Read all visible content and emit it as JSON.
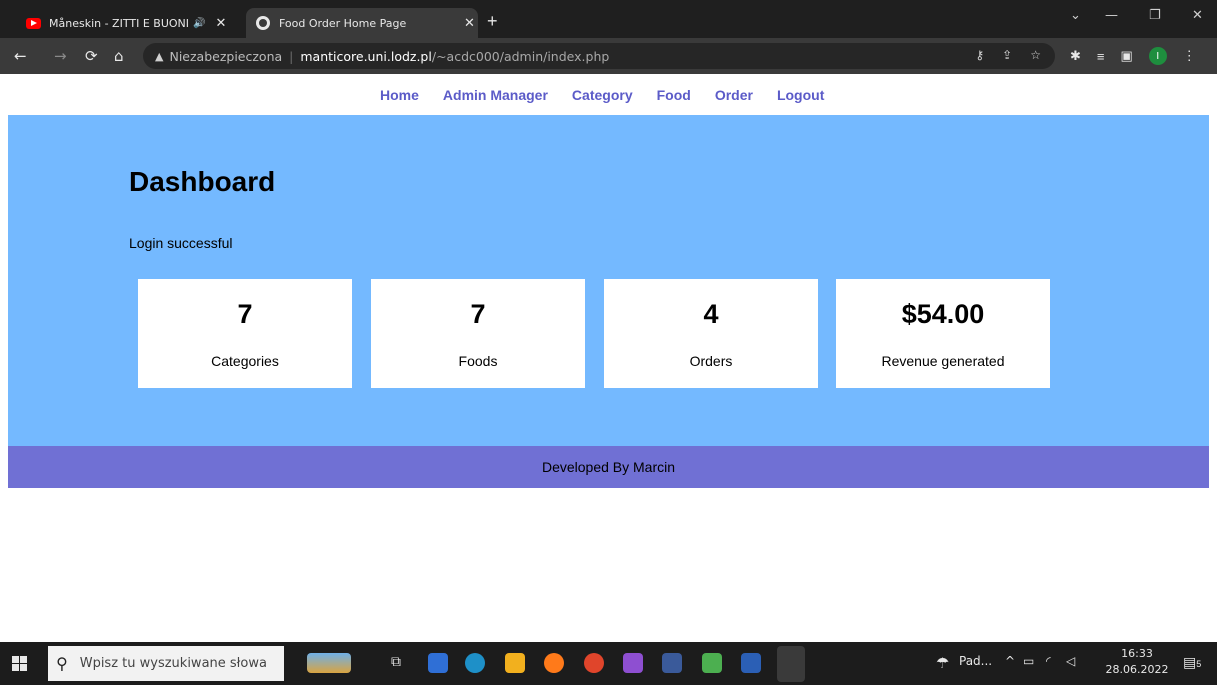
{
  "browser": {
    "tabs": [
      {
        "title": "Måneskin - ZITTI E BUONI (O",
        "close": "✕",
        "audio": "🔊"
      },
      {
        "title": "Food Order Home Page",
        "close": "✕"
      }
    ],
    "new_tab": "+",
    "window_controls": [
      "⌄",
      "—",
      "❐",
      "✕"
    ],
    "nav": {
      "back": "←",
      "forward": "→",
      "reload": "⟳",
      "home": "⌂"
    },
    "address": {
      "warning": "▲",
      "insecure_label": "Niezabezpieczona",
      "separator": "|",
      "host": "manticore.uni.lodz.pl",
      "path": "/~acdc000/admin/index.php"
    },
    "omni_icons": [
      "key-icon",
      "share-icon",
      "star-icon"
    ],
    "profile_initial": "I"
  },
  "menu": {
    "items": [
      "Home",
      "Admin Manager",
      "Category",
      "Food",
      "Order",
      "Logout"
    ]
  },
  "dashboard": {
    "title": "Dashboard",
    "message": "Login successful",
    "cards": [
      {
        "value": "7",
        "label": "Categories"
      },
      {
        "value": "7",
        "label": "Foods"
      },
      {
        "value": "4",
        "label": "Orders"
      },
      {
        "value": "$54.00",
        "label": "Revenue generated"
      }
    ]
  },
  "footer": {
    "text": "Developed By Marcin"
  },
  "taskbar": {
    "search_placeholder": "Wpisz tu wyszukiwane słowa",
    "weather_label": "Pad...",
    "time": "16:33",
    "date": "28.06.2022",
    "notifications": "5",
    "colors": {
      "edge": "#1e90c8",
      "explorer": "#f2b01e",
      "firefox": "#ff7a1a",
      "chrome": "#e0452b",
      "vs": "#8e4fd1",
      "word": "#2b5fb5"
    }
  },
  "theme": {
    "main_bg": "#74b9ff",
    "footer_bg": "#7070d4",
    "menu_link": "#5b5bc8"
  }
}
